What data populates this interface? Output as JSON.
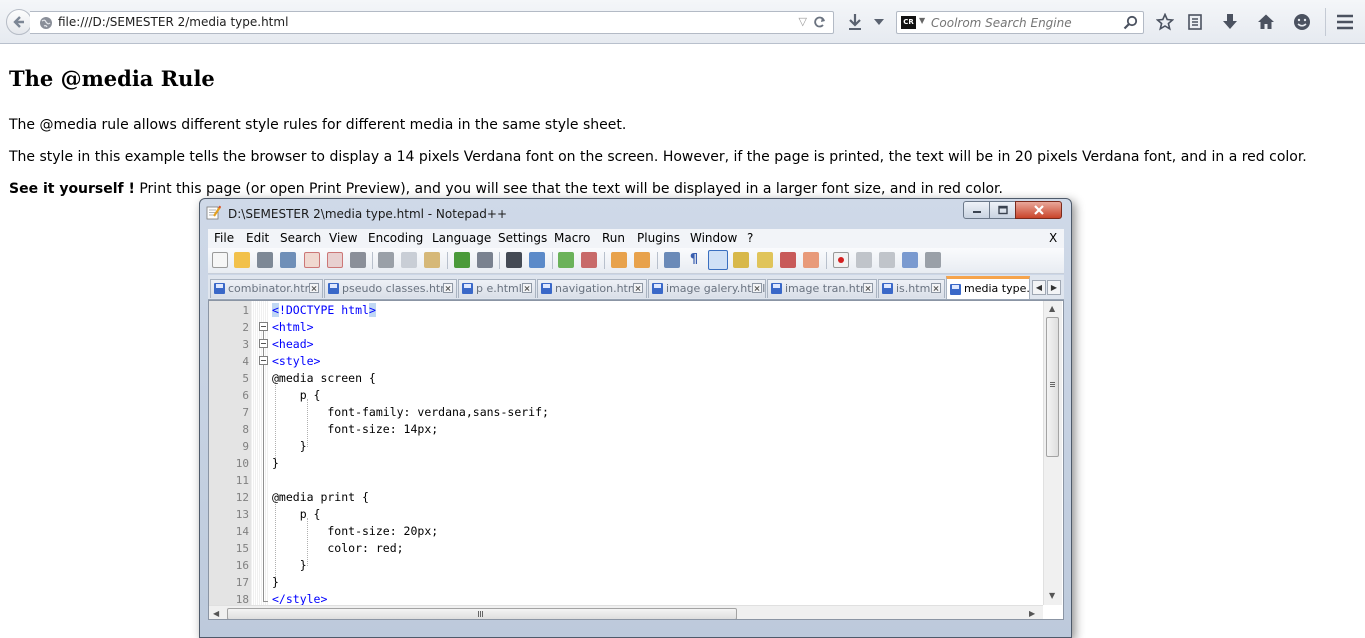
{
  "browser": {
    "url": "file:///D:/SEMESTER 2/media type.html",
    "search_placeholder": "Coolrom Search Engine",
    "search_engine_logo": "CR"
  },
  "page": {
    "heading": "The @media Rule",
    "para1": "The @media rule allows different style rules for different media in the same style sheet.",
    "para2": "The style in this example tells the browser to display a 14 pixels Verdana font on the screen. However, if the page is printed, the text will be in 20 pixels Verdana font, and in a red color.",
    "para3_bold": "See it yourself !",
    "para3_rest": " Print this page (or open Print Preview), and you will see that the text will be displayed in a larger font size, and in red color."
  },
  "notepad": {
    "title": "D:\\SEMESTER 2\\media type.html - Notepad++",
    "menu": [
      "File",
      "Edit",
      "Search",
      "View",
      "Encoding",
      "Language",
      "Settings",
      "Macro",
      "Run",
      "Plugins",
      "Window",
      "?"
    ],
    "menu_close": "X",
    "tabs": [
      {
        "label": "combinator.html",
        "active": false
      },
      {
        "label": "pseudo classes.html",
        "active": false
      },
      {
        "label": "p e.html",
        "active": false
      },
      {
        "label": "navigation.html",
        "active": false
      },
      {
        "label": "image galery.html",
        "active": false
      },
      {
        "label": "image tran.html",
        "active": false
      },
      {
        "label": "is.html",
        "active": false
      },
      {
        "label": "media type.ht",
        "active": true
      }
    ],
    "line_numbers": [
      "1",
      "2",
      "3",
      "4",
      "5",
      "6",
      "7",
      "8",
      "9",
      "10",
      "11",
      "12",
      "13",
      "14",
      "15",
      "16",
      "17",
      "18"
    ],
    "code": [
      "<!DOCTYPE html>",
      "<html>",
      "<head>",
      "<style>",
      "@media screen {",
      "    p {",
      "        font-family: verdana,sans-serif;",
      "        font-size: 14px;",
      "    }",
      "}",
      "",
      "@media print {",
      "    p {",
      "        font-size: 20px;",
      "        color: red;",
      "    }",
      "}",
      "</style>"
    ]
  },
  "colors": {
    "tag": "#0000ff",
    "active_tab_accent": "#f6a44c"
  }
}
